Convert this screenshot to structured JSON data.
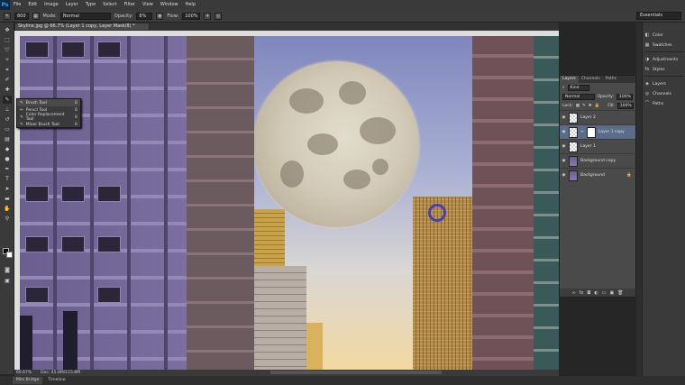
{
  "app": {
    "logo": "Ps"
  },
  "menu": [
    "File",
    "Edit",
    "Image",
    "Layer",
    "Type",
    "Select",
    "Filter",
    "View",
    "Window",
    "Help"
  ],
  "options": {
    "brush_size": "800",
    "mode_label": "Mode:",
    "mode_value": "Normal",
    "opacity_label": "Opacity:",
    "opacity_value": "8%",
    "flow_label": "Flow:",
    "flow_value": "100%",
    "workspace": "Essentials"
  },
  "document": {
    "tab_title": "Skyline.jpg @ 66.7% (Layer 1 copy, Layer Mask/8) *",
    "zoom": "66.67%",
    "doc_info": "Doc: 45.8M/115.8M"
  },
  "flyout": {
    "items": [
      {
        "icon": "brush-icon",
        "label": "Brush Tool",
        "key": "B",
        "selected": true
      },
      {
        "icon": "pencil-icon",
        "label": "Pencil Tool",
        "key": "B",
        "selected": false
      },
      {
        "icon": "color-replace-icon",
        "label": "Color Replacement Tool",
        "key": "B",
        "selected": false
      },
      {
        "icon": "mixer-brush-icon",
        "label": "Mixer Brush Tool",
        "key": "B",
        "selected": false
      }
    ]
  },
  "layers_panel": {
    "tabs": [
      "Layers",
      "Channels",
      "Paths"
    ],
    "kind_value": "Kind",
    "blend_mode": "Normal",
    "opacity_label": "Opacity:",
    "opacity_value": "100%",
    "lock_label": "Lock:",
    "fill_label": "Fill:",
    "fill_value": "100%",
    "layers": [
      {
        "name": "Layer 2",
        "thumb": "transparent",
        "selected": false
      },
      {
        "name": "Layer 1 copy",
        "thumb": "transparent",
        "has_mask": true,
        "selected": true
      },
      {
        "name": "Layer 1",
        "thumb": "transparent",
        "selected": false
      },
      {
        "name": "Background copy",
        "thumb": "photo",
        "selected": false
      },
      {
        "name": "Background",
        "thumb": "photo",
        "selected": false,
        "locked": true
      }
    ]
  },
  "dock": {
    "items": [
      "Color",
      "Swatches",
      "Adjustments",
      "Styles",
      "Layers",
      "Channels",
      "Paths"
    ]
  },
  "bottom_tabs": [
    "Mini Bridge",
    "Timeline"
  ],
  "colors": {
    "selection": "#5a6c88",
    "ui_dark": "#3a3a3a",
    "ps_blue": "#31a8ff"
  }
}
